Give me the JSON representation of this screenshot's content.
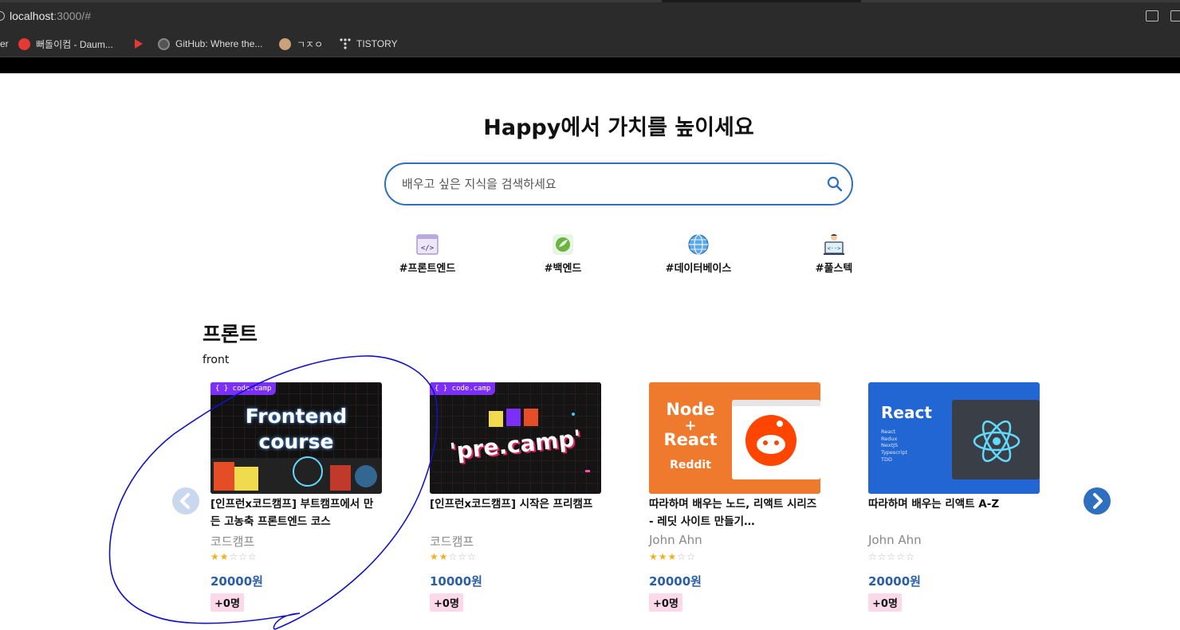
{
  "browser": {
    "url_host": "localhost",
    "url_rest": ":3000/#",
    "bookmarks": [
      {
        "label": "er",
        "color": ""
      },
      {
        "label": "뻐돌이컴 - Daum...",
        "color": "#e53935"
      },
      {
        "label": "",
        "color": "#e53935"
      },
      {
        "label": "GitHub: Where the...",
        "color": "#6e6e6e"
      },
      {
        "label": "ㄱㅈㅇ",
        "color": "#c9a27a"
      },
      {
        "label": "TISTORY",
        "color": "#dcdcdc"
      }
    ]
  },
  "hero": {
    "title": "Happy에서 가치를 높이세요",
    "search_placeholder": "배우고 싶은 지식을 검색하세요"
  },
  "categories": [
    {
      "label": "#프론트엔드",
      "icon": "code-window-icon"
    },
    {
      "label": "#백엔드",
      "icon": "spring-leaf-icon"
    },
    {
      "label": "#데이터베이스",
      "icon": "globe-icon"
    },
    {
      "label": "#풀스텍",
      "icon": "developer-icon"
    }
  ],
  "section": {
    "title": "프론트",
    "subtitle": "front"
  },
  "courses": [
    {
      "thumb": {
        "badge": "{ } code.camp",
        "line1": "Frontend",
        "line2": "course",
        "bg": "#111111"
      },
      "title": "[인프런x코드캠프] 부트캠프에서 만든 고농축 프론트엔드 코스",
      "author": "코드캠프",
      "rating": 2,
      "price": "20000원",
      "students": "+0명"
    },
    {
      "thumb": {
        "badge": "{ } code.camp",
        "line1": "'pre.camp'",
        "line2": "",
        "bg": "#141414"
      },
      "title": "[인프런x코드캠프] 시작은 프리캠프",
      "author": "코드캠프",
      "rating": 2,
      "price": "10000원",
      "students": "+0명"
    },
    {
      "thumb": {
        "badge": "",
        "line1": "Node",
        "line2": "React",
        "sub": "Reddit",
        "bg": "#ef7a2e"
      },
      "title": "따라하며 배우는 노드, 리액트 시리즈 - 레딧 사이트 만들기…",
      "author": "John Ahn",
      "rating": 3,
      "price": "20000원",
      "students": "+0명"
    },
    {
      "thumb": {
        "badge": "",
        "line1": "React",
        "line2": "",
        "list": [
          "React",
          "Redux",
          "NextJS",
          "Typescript",
          "TDD"
        ],
        "bg": "#2266d4"
      },
      "title": "따라하며 배우는 리액트 A-Z",
      "author": "John Ahn",
      "rating": 0,
      "price": "20000원",
      "students": "+0명"
    }
  ],
  "colors": {
    "accent": "#2f6fc0",
    "price": "#2a5fa6",
    "badge_bg": "#fbd9e8",
    "star": "#f2b01e",
    "annotation": "#1212c8"
  }
}
